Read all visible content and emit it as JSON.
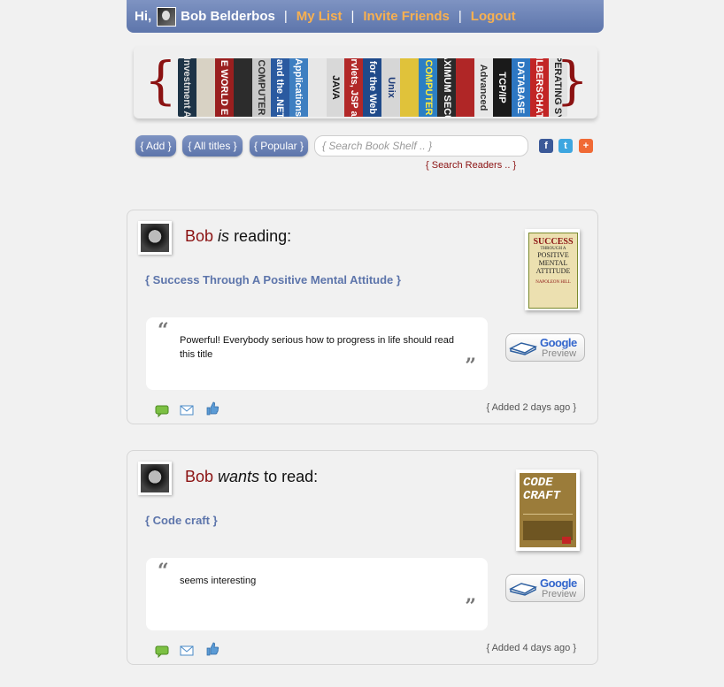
{
  "topbar": {
    "greeting": "Hi,",
    "user_name": "Bob Belderbos",
    "separator": "|",
    "my_list": "My List",
    "invite": "Invite Friends",
    "logout": "Logout"
  },
  "banner": {
    "left_brace": "{",
    "right_brace": "}",
    "spines": [
      {
        "color": "#1d3346",
        "text": "Investment A",
        "tc": "#ddd"
      },
      {
        "color": "#d8d2c4",
        "text": "",
        "tc": "#333"
      },
      {
        "color": "#9a1f1f",
        "text": "E WORLD E",
        "tc": "#fff"
      },
      {
        "color": "#2c2c2c",
        "text": "",
        "tc": "#fff"
      },
      {
        "color": "#c9c9c9",
        "text": "COMPUTER",
        "tc": "#333"
      },
      {
        "color": "#2a5aa0",
        "text": "C# and the .NET Fr",
        "tc": "#fff"
      },
      {
        "color": "#3e7fc1",
        "text": "Applications",
        "tc": "#fff"
      },
      {
        "color": "#e7e7e7",
        "text": "",
        "tc": "#333"
      },
      {
        "color": "#d8d8d8",
        "text": "JAVA",
        "tc": "#111"
      },
      {
        "color": "#b22828",
        "text": "Servlets, JSP and",
        "tc": "#fff"
      },
      {
        "color": "#1f4a8a",
        "text": "for the Web",
        "tc": "#fff"
      },
      {
        "color": "#d6d6d6",
        "text": "Unix",
        "tc": "#1d3b79"
      },
      {
        "color": "#e0c23a",
        "text": "",
        "tc": "#111"
      },
      {
        "color": "#2b7fc4",
        "text": "COMPUTER",
        "tc": "#ffeb3b"
      },
      {
        "color": "#2a2a2a",
        "text": "AXIMUM SECU",
        "tc": "#fff"
      },
      {
        "color": "#b02626",
        "text": "",
        "tc": "#fff"
      },
      {
        "color": "#e7e7e7",
        "text": "Advanced",
        "tc": "#333"
      },
      {
        "color": "#1a1a1a",
        "text": "TCP/IP",
        "tc": "#fff"
      },
      {
        "color": "#2d77c2",
        "text": "DATABASE",
        "tc": "#fff"
      },
      {
        "color": "#c22525",
        "text": "SILBERSCHATZ",
        "tc": "#fff"
      },
      {
        "color": "#e2e2e2",
        "text": "OPERATING SYS",
        "tc": "#222"
      }
    ]
  },
  "actions": {
    "add": "{ Add }",
    "all_titles": "{ All titles }",
    "popular": "{ Popular }",
    "search_placeholder": "{ Search Book Shelf .. }",
    "search_readers": "{ Search Readers .. }",
    "facebook": "f",
    "twitter": "t",
    "addthis": "+"
  },
  "posts": [
    {
      "user": "Bob",
      "verb": "is",
      "action": "reading:",
      "title": "{ Success Through A Positive Mental Attitude }",
      "quote": "Powerful! Everybody serious how to progress in life should read this title",
      "added": "{ Added 2 days ago }",
      "google": "Google",
      "preview": "Preview",
      "cover": {
        "title1": "SUCCESS",
        "title2": "THROUGH A",
        "title3": "POSITIVE",
        "title4": "MENTAL",
        "title5": "ATTITUDE",
        "author": "NAPOLEON HILL"
      }
    },
    {
      "user": "Bob",
      "verb": "wants",
      "action": "to read:",
      "title": "{ Code craft }",
      "quote": "seems interesting",
      "added": "{ Added 4 days ago }",
      "google": "Google",
      "preview": "Preview",
      "cover": {
        "title1": "CODE",
        "title2": "CRAFT"
      }
    }
  ],
  "colors": {
    "accent": "#5d75ab",
    "link_orange": "#f8b050",
    "dark_red": "#8b1212"
  }
}
